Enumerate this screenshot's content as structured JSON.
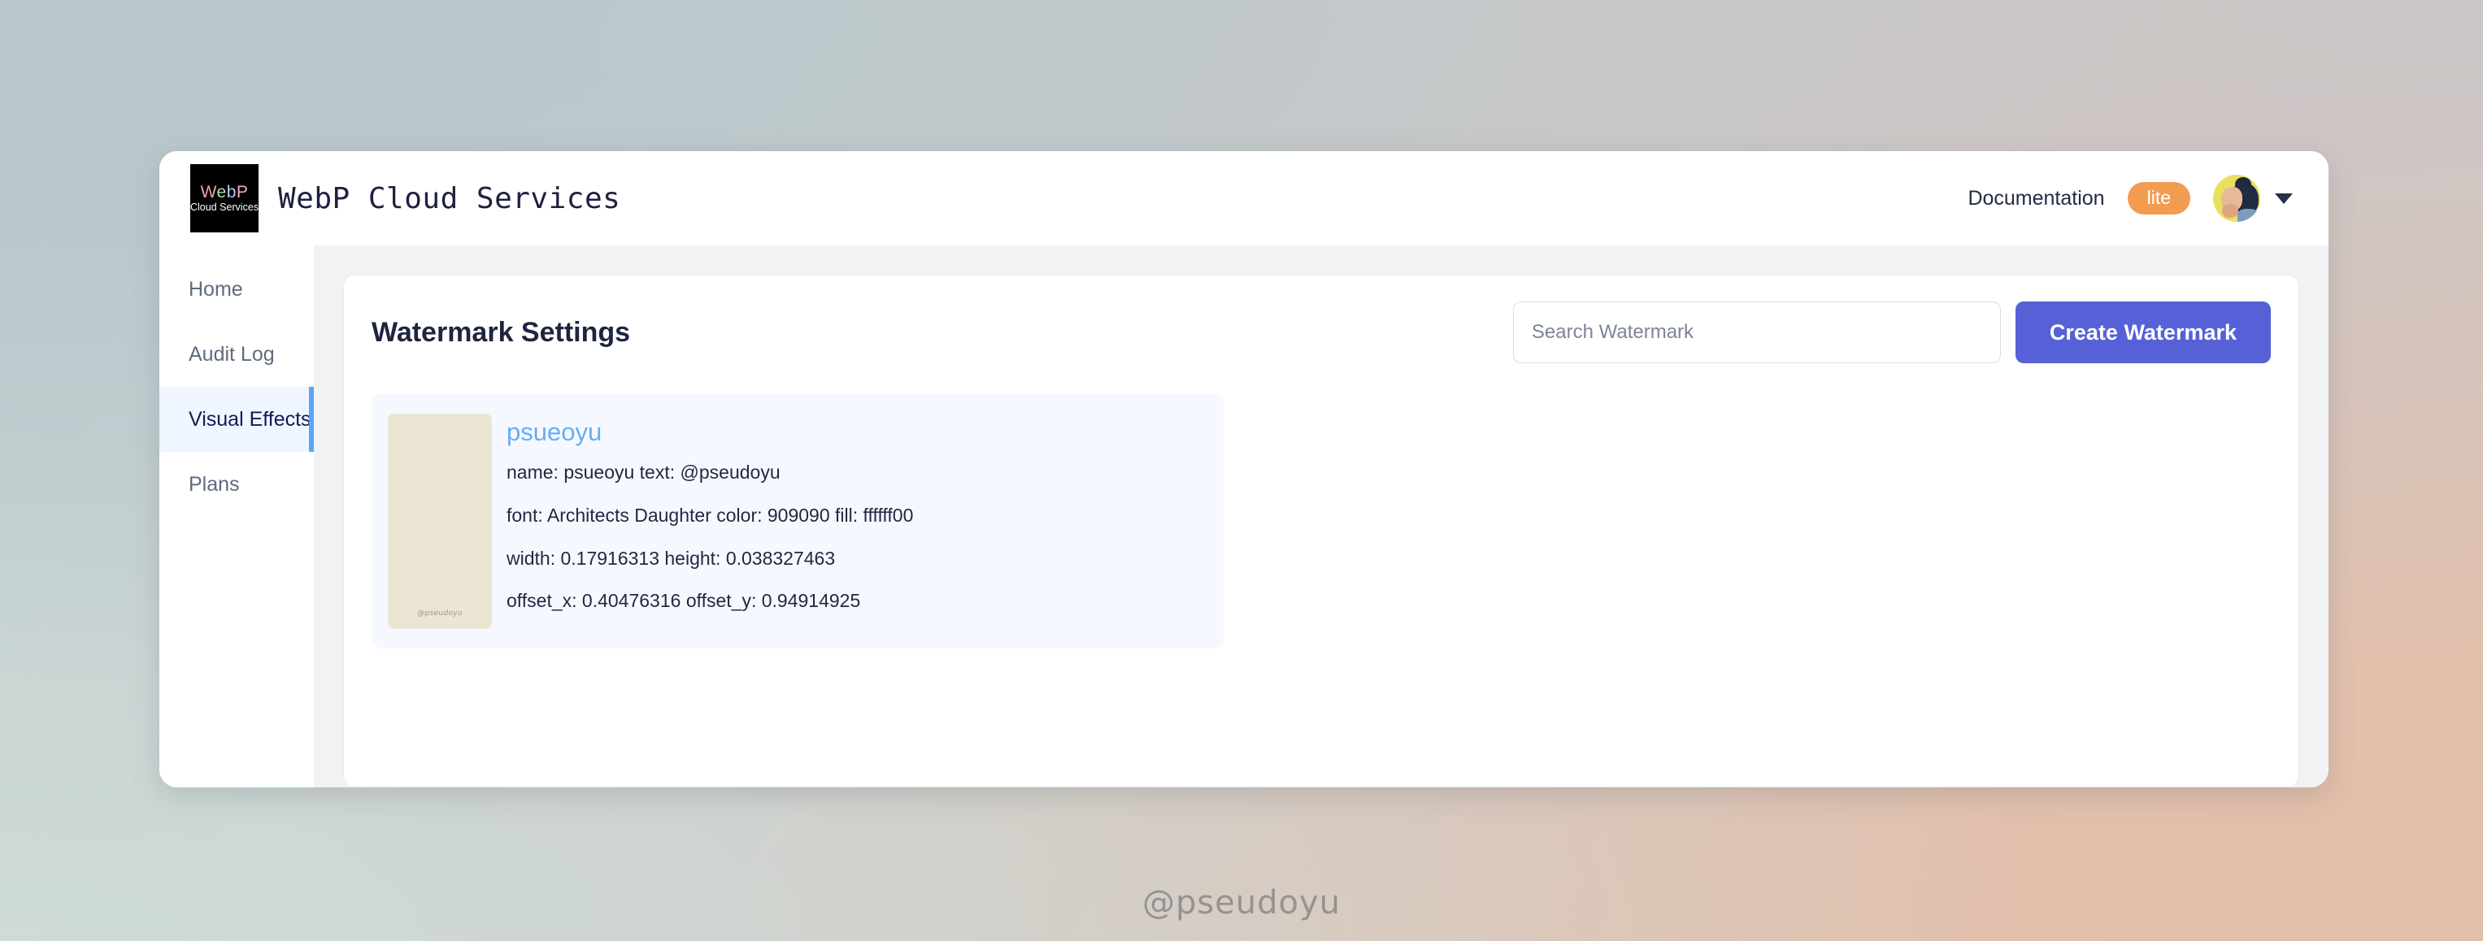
{
  "background": {
    "gradient_from": "#bdcbcf",
    "gradient_to": "#e3bfaa",
    "corner_top_left": "#b7c7cb",
    "corner_top_right": "#cbc7c8",
    "corner_bottom_left": "#cfdbd8",
    "corner_bottom_right": "#e3bfaa"
  },
  "header": {
    "logo": {
      "word_w": "W",
      "word_e": "e",
      "word_b": "b",
      "word_p": "P",
      "subtitle": "Cloud Services"
    },
    "title": "WebP Cloud Services",
    "documentation_label": "Documentation",
    "plan_badge": "lite",
    "plan_badge_color": "#f29c52",
    "avatar_alt": "user-avatar",
    "chevron": "▼"
  },
  "sidebar": {
    "items": [
      {
        "label": "Home",
        "active": false
      },
      {
        "label": "Audit Log",
        "active": false
      },
      {
        "label": "Visual Effects",
        "active": true
      },
      {
        "label": "Plans",
        "active": false
      }
    ],
    "active_accent_color": "#5aa6f5",
    "active_background": "#eff6ff"
  },
  "main": {
    "page_title": "Watermark Settings",
    "search": {
      "value": "",
      "placeholder": "Search Watermark"
    },
    "create_button": {
      "label": "Create Watermark",
      "color": "#5761d7"
    },
    "watermarks": [
      {
        "name_link": "psueoyu",
        "thumbnail": {
          "background": "#ece5d4",
          "mark_text": "@pseudoyu"
        },
        "fields": [
          {
            "label_a": "name:",
            "value_a": "psueoyu",
            "label_b": "text:",
            "value_b": "@pseudoyu"
          },
          {
            "label_a": "font:",
            "value_a": "Architects Daughter",
            "label_b": "color:",
            "value_b": "909090",
            "label_c": "fill:",
            "value_c": "ffffff00"
          },
          {
            "label_a": "width:",
            "value_a": "0.17916313",
            "label_b": "height:",
            "value_b": "0.038327463"
          },
          {
            "label_a": "offset_x:",
            "value_a": "0.40476316",
            "label_b": "offset_y:",
            "value_b": "0.94914925"
          }
        ],
        "line1": "name: psueoyu  text: @pseudoyu",
        "line2": "font: Architects Daughter  color: 909090  fill: ffffff00",
        "line3": "width: 0.17916313  height: 0.038327463",
        "line4": "offset_x: 0.40476316  offset_y: 0.94914925"
      }
    ]
  },
  "page_watermark": "@pseudoyu"
}
